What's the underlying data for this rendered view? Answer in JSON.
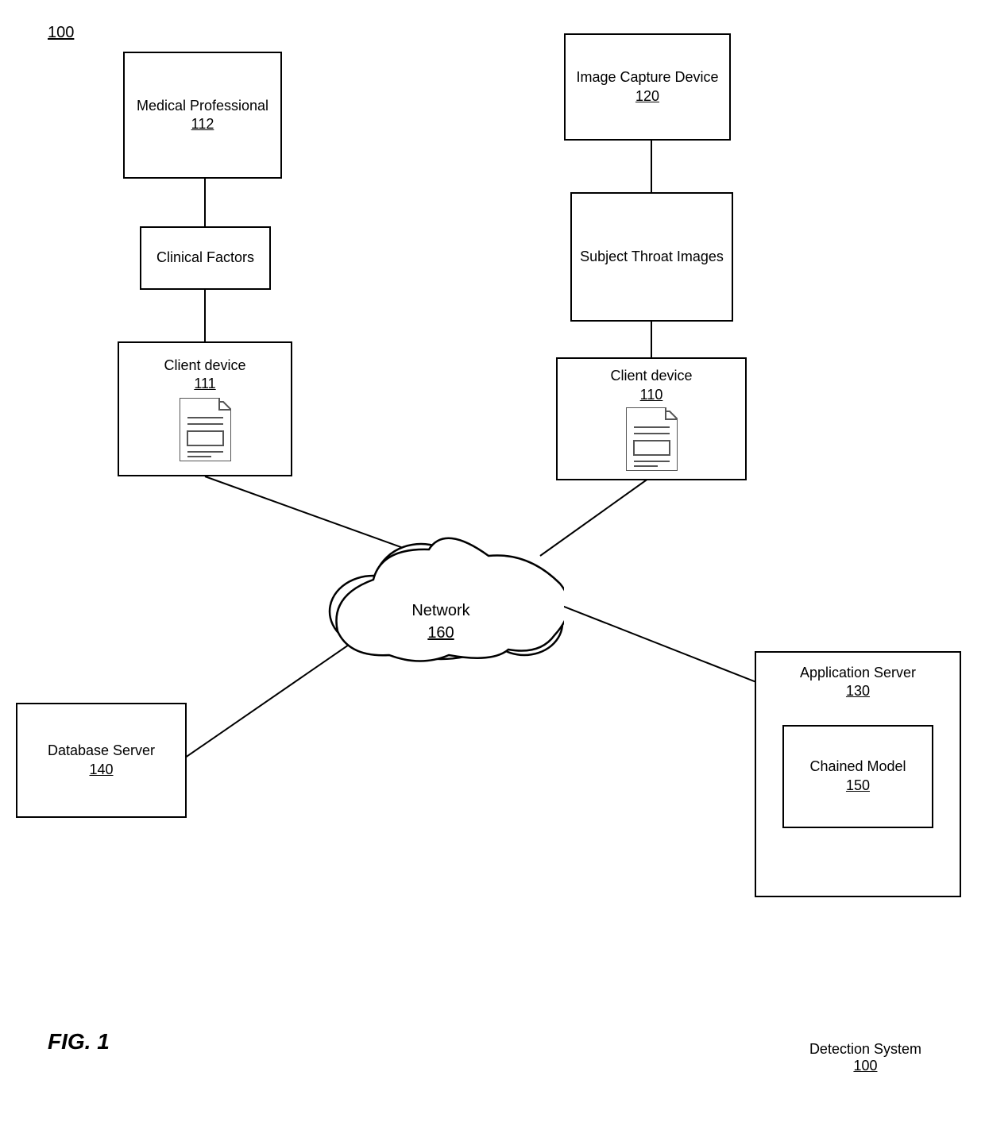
{
  "diagram": {
    "title": "100",
    "fig_label": "FIG. 1",
    "detection_system_label": "Detection System",
    "detection_system_number": "100",
    "nodes": {
      "medical_professional": {
        "label": "Medical Professional",
        "number": "112"
      },
      "image_capture_device": {
        "label": "Image Capture Device",
        "number": "120"
      },
      "subject_throat_images": {
        "label": "Subject Throat Images",
        "number": null
      },
      "clinical_factors": {
        "label": "Clinical Factors",
        "number": null
      },
      "client_device_111": {
        "label": "Client device",
        "number": "111"
      },
      "client_device_110": {
        "label": "Client device",
        "number": "110"
      },
      "network": {
        "label": "Network",
        "number": "160"
      },
      "database_server": {
        "label": "Database Server",
        "number": "140"
      },
      "application_server": {
        "label": "Application Server",
        "number": "130"
      },
      "chained_model": {
        "label": "Chained Model",
        "number": "150"
      }
    }
  }
}
